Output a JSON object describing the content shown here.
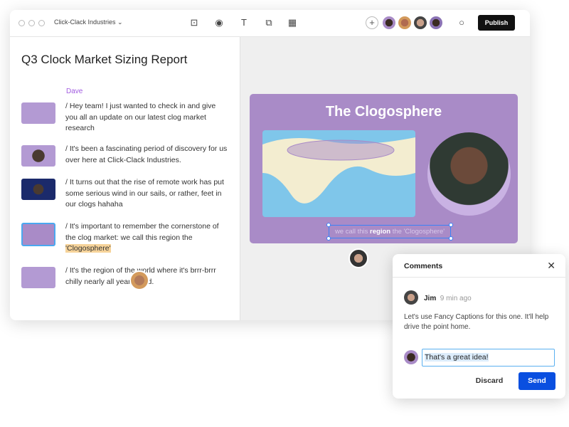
{
  "toolbar": {
    "workspace": "Click-Clack Industries",
    "publish_label": "Publish",
    "add_label": "+"
  },
  "doc": {
    "title": "Q3 Clock Market Sizing Report",
    "speaker": "Dave",
    "lines": [
      "/ Hey team! I just wanted to check in and give you all an update on our latest clog market research",
      "/ It's been a fascinating period of discovery for us over here at Click-Clack Industries.",
      "/ It turns out that the rise of remote work has put some serious wind in our sails, or rather, feet in our clogs hahaha",
      "/ It's important to remember the cornerstone of the clog market: we call this region the",
      "/ It's the region of the world where it's brrr-brrr chilly nearly all year round."
    ],
    "highlight": "'Clogosphere'"
  },
  "slide": {
    "title": "The Clogosphere",
    "caption_pre": "we call this ",
    "caption_bold": "region",
    "caption_post": " the 'Clogosphere'",
    "bg": "#a98bc7"
  },
  "comments": {
    "title": "Comments",
    "author": "Jim",
    "time": "9 min ago",
    "body": "Let's use Fancy Captions for this one. It'll help drive the point home.",
    "reply": "That's a great idea!",
    "discard": "Discard",
    "send": "Send",
    "send_color": "#0a4fe0"
  }
}
